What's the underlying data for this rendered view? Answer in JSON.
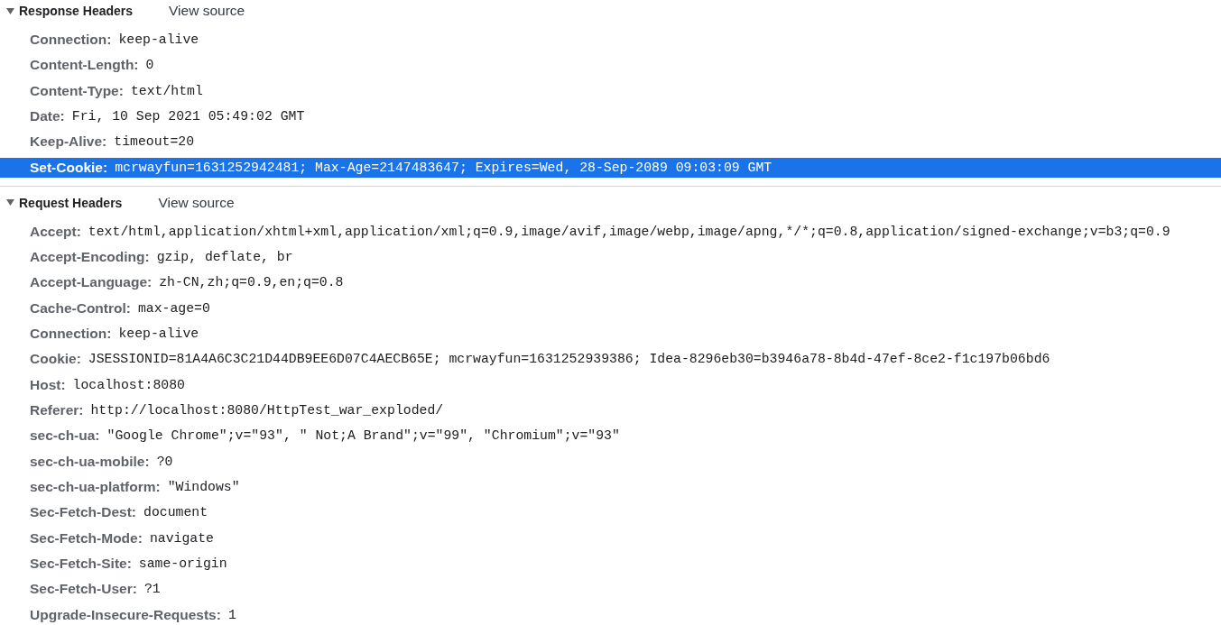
{
  "sections": [
    {
      "title": "Response Headers",
      "expanded": true,
      "view_source": "View source",
      "headers": [
        {
          "name": "Connection:",
          "value": "keep-alive",
          "selected": false
        },
        {
          "name": "Content-Length:",
          "value": "0",
          "selected": false
        },
        {
          "name": "Content-Type:",
          "value": "text/html",
          "selected": false
        },
        {
          "name": "Date:",
          "value": "Fri, 10 Sep 2021 05:49:02 GMT",
          "selected": false
        },
        {
          "name": "Keep-Alive:",
          "value": "timeout=20",
          "selected": false
        },
        {
          "name": "Set-Cookie:",
          "value": "mcrwayfun=1631252942481; Max-Age=2147483647; Expires=Wed, 28-Sep-2089 09:03:09 GMT",
          "selected": true
        }
      ]
    },
    {
      "title": "Request Headers",
      "expanded": true,
      "view_source": "View source",
      "headers": [
        {
          "name": "Accept:",
          "value": "text/html,application/xhtml+xml,application/xml;q=0.9,image/avif,image/webp,image/apng,*/*;q=0.8,application/signed-exchange;v=b3;q=0.9",
          "selected": false
        },
        {
          "name": "Accept-Encoding:",
          "value": "gzip, deflate, br",
          "selected": false
        },
        {
          "name": "Accept-Language:",
          "value": "zh-CN,zh;q=0.9,en;q=0.8",
          "selected": false
        },
        {
          "name": "Cache-Control:",
          "value": "max-age=0",
          "selected": false
        },
        {
          "name": "Connection:",
          "value": "keep-alive",
          "selected": false
        },
        {
          "name": "Cookie:",
          "value": "JSESSIONID=81A4A6C3C21D44DB9EE6D07C4AECB65E; mcrwayfun=1631252939386; Idea-8296eb30=b3946a78-8b4d-47ef-8ce2-f1c197b06bd6",
          "selected": false
        },
        {
          "name": "Host:",
          "value": "localhost:8080",
          "selected": false
        },
        {
          "name": "Referer:",
          "value": "http://localhost:8080/HttpTest_war_exploded/",
          "selected": false
        },
        {
          "name": "sec-ch-ua:",
          "value": "\"Google Chrome\";v=\"93\", \" Not;A Brand\";v=\"99\", \"Chromium\";v=\"93\"",
          "selected": false
        },
        {
          "name": "sec-ch-ua-mobile:",
          "value": "?0",
          "selected": false
        },
        {
          "name": "sec-ch-ua-platform:",
          "value": "\"Windows\"",
          "selected": false
        },
        {
          "name": "Sec-Fetch-Dest:",
          "value": "document",
          "selected": false
        },
        {
          "name": "Sec-Fetch-Mode:",
          "value": "navigate",
          "selected": false
        },
        {
          "name": "Sec-Fetch-Site:",
          "value": "same-origin",
          "selected": false
        },
        {
          "name": "Sec-Fetch-User:",
          "value": "?1",
          "selected": false
        },
        {
          "name": "Upgrade-Insecure-Requests:",
          "value": "1",
          "selected": false
        }
      ]
    }
  ]
}
